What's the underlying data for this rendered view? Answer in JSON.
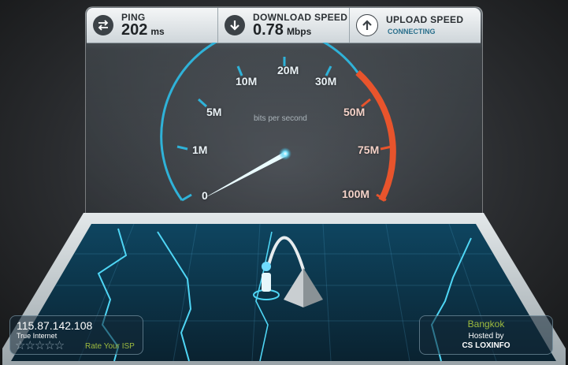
{
  "ping": {
    "label": "PING",
    "value": "202",
    "unit": "ms"
  },
  "download": {
    "label": "DOWNLOAD SPEED",
    "value": "0.78",
    "unit": "Mbps"
  },
  "upload": {
    "label": "UPLOAD SPEED",
    "status": "CONNECTING"
  },
  "gauge": {
    "caption": "bits per second",
    "ticks": [
      "0",
      "1M",
      "5M",
      "10M",
      "20M",
      "30M",
      "50M",
      "75M",
      "100M"
    ],
    "current_mbps": 0.78,
    "colors": {
      "normal": "#2fb2d8",
      "hot": "#e8542c",
      "needle": "#eafcff"
    }
  },
  "client": {
    "ip": "115.87.142.108",
    "isp": "True Internet",
    "rating_stars": 5,
    "rate_label": "Rate Your ISP"
  },
  "server": {
    "city": "Bangkok",
    "hosted_label": "Hosted by",
    "host": "CS LOXINFO"
  }
}
